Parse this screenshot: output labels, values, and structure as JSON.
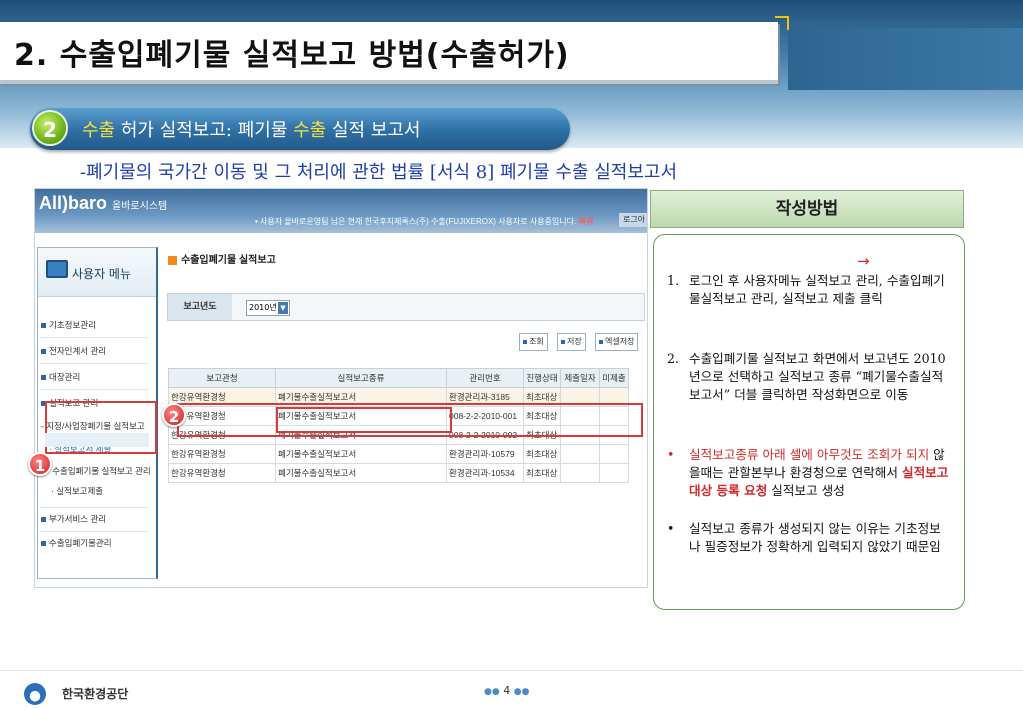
{
  "slide": {
    "title": "2. 수출입폐기물 실적보고 방법(수출허가)",
    "section_number": "2",
    "section_heading_prefix": "수출",
    "section_heading_mid": " 허가 실적보고: 폐기물 ",
    "section_heading_hl": "수출",
    "section_heading_suffix": " 실적 보고서",
    "subtitle": "-폐기물의 국가간 이동 및 그 처리에 관한 법률 [서식 8] 폐기물 수출 실적보고서",
    "page_number": "4",
    "org_name": "한국환경공단"
  },
  "screenshot": {
    "logo": "All)baro",
    "logo_sub": "올바로시스템",
    "notice": "• 사용자 올바로운영팀 님은 현재 한국후지제록스(주) 수출(FUJIXEROX) 사용자로 사용중입니다.",
    "notice_link": "복귀",
    "login_btn": "로그아",
    "user_menu_title": "사용자 메뉴",
    "menu_items": [
      "기초정보관리",
      "전자인계서 관리",
      "대장관리",
      "실적보고 관리",
      "- 지정/사업장폐기물 실적보고",
      "· 실적보고서 제출",
      "- 수출입폐기물 실적보고 관리",
      "· 실적보고제출",
      "부가서비스 관리",
      "수출입폐기물관리"
    ],
    "main_title": "수출입폐기물 실적보고",
    "year_label": "보고년도",
    "year_value": "2010년",
    "buttons": [
      "조회",
      "저장",
      "엑셀저장"
    ],
    "table": {
      "headers": [
        "보고관청",
        "실적보고종류",
        "관리번호",
        "진행상태",
        "제출일자",
        "미제출"
      ],
      "rows": [
        [
          "한강유역환경청",
          "폐기물수출실적보고서",
          "환경관리과-3185",
          "최초대상",
          "",
          ""
        ],
        [
          "한강유역환경청",
          "폐기물수출실적보고서",
          "008-2-2-2010-001",
          "최초대상",
          "",
          ""
        ],
        [
          "한강유역환경청",
          "폐기물수출실적보고서",
          "008-2-2-2010-002",
          "최초대상",
          "",
          ""
        ],
        [
          "한강유역환경청",
          "폐기물수출실적보고서",
          "환경관리과-10579",
          "최초대상",
          "",
          ""
        ],
        [
          "한강유역환경청",
          "폐기물수출실적보고서",
          "환경관리과-10534",
          "최초대상",
          "",
          ""
        ]
      ]
    },
    "badge1": "1",
    "badge2": "2"
  },
  "method": {
    "header": "작성방법",
    "step1_num": "1.",
    "step1_text": "로그인 후 사용자메뉴  실적보고 관리, 수출입폐기물실적보고 관리, 실적보고 제출 클릭",
    "step2_num": "2.",
    "step2_text": "수출입폐기물 실적보고 화면에서 보고년도 2010년으로 선택하고 실적보고 종류 “폐기물수출실적보고서” 더블 클릭하면 작성화면으로 이동",
    "bullet1_red": "실적보고종류 아래 셀에 아무것도 조회가 되지",
    "bullet1_mid": " 않을때는 관할본부나 환경청으로 연락해서 ",
    "bullet1_bold": "실적보고 대상 등록 요청",
    "bullet1_end": " 실적보고 생성",
    "bullet2": "실적보고 종류가 생성되지 않는 이유는 기초정보나 필증정보가 정확하게 입력되지 않았기 때문임",
    "bullet_symbol": "•",
    "arrow": "→"
  },
  "colors": {
    "accent_red": "#d12a2a",
    "subtitle_blue": "#1f3fa8",
    "pill_blue": "#2e6fa3",
    "highlight_yellow": "#f5e23b"
  }
}
